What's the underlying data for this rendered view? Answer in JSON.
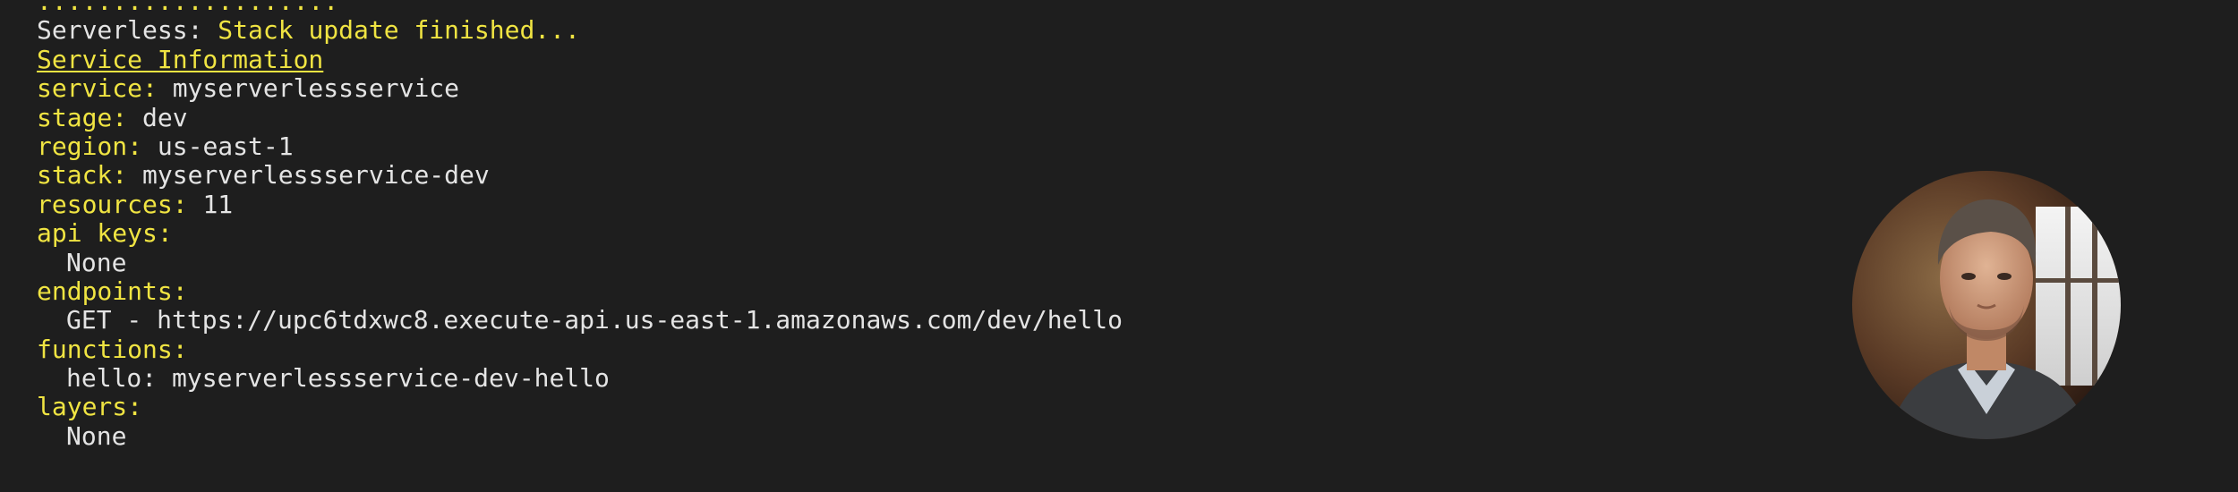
{
  "terminal": {
    "dots": "....................",
    "status_prefix": "Serverless:",
    "status_message": "Stack update finished...",
    "section_title": "Service Information",
    "service_key": "service:",
    "service_value": "myserverlessservice",
    "stage_key": "stage:",
    "stage_value": "dev",
    "region_key": "region:",
    "region_value": "us-east-1",
    "stack_key": "stack:",
    "stack_value": "myserverlessservice-dev",
    "resources_key": "resources:",
    "resources_value": "11",
    "api_keys_key": "api keys:",
    "api_keys_value": "None",
    "endpoints_key": "endpoints:",
    "endpoint_value": "GET - https://upc6tdxwc8.execute-api.us-east-1.amazonaws.com/dev/hello",
    "functions_key": "functions:",
    "function_value": "hello: myserverlessservice-dev-hello",
    "layers_key": "layers:",
    "layers_value": "None"
  },
  "colors": {
    "background": "#1e1e1e",
    "text": "#e4e4e4",
    "highlight": "#f0e442"
  },
  "avatar": {
    "icon": "person-photo-icon"
  }
}
